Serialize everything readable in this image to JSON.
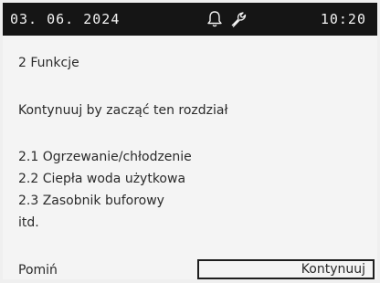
{
  "status_bar": {
    "date": "03. 06. 2024",
    "time": "10:20",
    "icons": [
      "bell-icon",
      "wrench-icon"
    ]
  },
  "content": {
    "section_title": "2 Funkcje",
    "instruction": "Kontynuuj by zacząć ten rozdział",
    "items": [
      "2.1 Ogrzewanie/chłodzenie",
      "2.2 Ciepła woda użytkowa",
      "2.3 Zasobnik buforowy",
      "itd."
    ]
  },
  "footer": {
    "skip_label": "Pomiń",
    "continue_label": "Kontynuuj"
  },
  "colors": {
    "status_bar_bg": "#151515",
    "screen_bg": "#f4f4f4",
    "text": "#2a2a2a"
  }
}
